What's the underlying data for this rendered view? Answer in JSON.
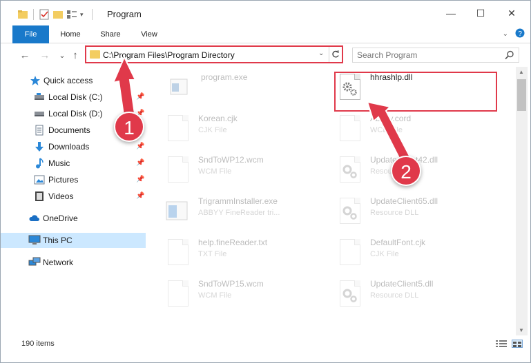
{
  "window": {
    "title": "Program",
    "controls": {
      "minimize": "—",
      "maximize": "☐",
      "close": "✕"
    }
  },
  "ribbon": {
    "tabs": [
      {
        "label": "File",
        "active": true
      },
      {
        "label": "Home"
      },
      {
        "label": "Share"
      },
      {
        "label": "View"
      }
    ]
  },
  "navigation": {
    "back": "←",
    "forward": "→",
    "recent": "⌄",
    "up": "↑",
    "address": "C:\\Program Files\\Program Directory",
    "search_placeholder": "Search Program"
  },
  "sidebar": {
    "items": [
      {
        "label": "Quick access",
        "icon": "star-icon",
        "pinned": false
      },
      {
        "label": "Local Disk (C:)",
        "icon": "drive-icon",
        "pinned": true
      },
      {
        "label": "Local Disk (D:)",
        "icon": "drive-icon",
        "pinned": true
      },
      {
        "label": "Documents",
        "icon": "documents-icon",
        "pinned": true
      },
      {
        "label": "Downloads",
        "icon": "download-icon",
        "pinned": true
      },
      {
        "label": "Music",
        "icon": "music-icon",
        "pinned": true
      },
      {
        "label": "Pictures",
        "icon": "pictures-icon",
        "pinned": true
      },
      {
        "label": "Videos",
        "icon": "videos-icon",
        "pinned": true
      },
      {
        "label": "OneDrive",
        "icon": "cloud-icon",
        "pinned": false
      },
      {
        "label": "This PC",
        "icon": "computer-icon",
        "pinned": false,
        "selected": true
      },
      {
        "label": "Network",
        "icon": "network-icon",
        "pinned": false
      }
    ]
  },
  "files": [
    {
      "name": "program.exe",
      "type": "",
      "icon": "exe-icon",
      "faded": true
    },
    {
      "name": "hhrashlp.dll",
      "type": "",
      "icon": "dll-gear-icon",
      "faded": false,
      "highlighted": true
    },
    {
      "name": "Korean.cjk",
      "type": "CJK File",
      "icon": "blank-file-icon",
      "faded": true
    },
    {
      "name": "Abbyy.cord",
      "type": "WCD File",
      "icon": "blank-file-icon",
      "faded": true
    },
    {
      "name": "SndToWP12.wcm",
      "type": "WCM File",
      "icon": "blank-file-icon",
      "faded": true
    },
    {
      "name": "UpdateClient42.dll",
      "type": "Resource DLL",
      "icon": "dll-gear-icon",
      "faded": true
    },
    {
      "name": "TrigrammInstaller.exe",
      "type": "ABBYY FineReader tri...",
      "icon": "exe-icon",
      "faded": true
    },
    {
      "name": "UpdateClient65.dll",
      "type": "Resource DLL",
      "icon": "dll-gear-icon",
      "faded": true
    },
    {
      "name": "help.fineReader.txt",
      "type": "TXT File",
      "icon": "text-file-icon",
      "faded": true
    },
    {
      "name": "DefaultFont.cjk",
      "type": "CJK File",
      "icon": "blank-file-icon",
      "faded": true
    },
    {
      "name": "SndToWP15.wcm",
      "type": "WCM File",
      "icon": "blank-file-icon",
      "faded": true
    },
    {
      "name": "UpdateClient5.dll",
      "type": "Resource DLL",
      "icon": "dll-gear-icon",
      "faded": true
    }
  ],
  "status": {
    "item_count": "190 items"
  },
  "annotations": {
    "step1": "1",
    "step2": "2",
    "accent": "#e0394a"
  }
}
